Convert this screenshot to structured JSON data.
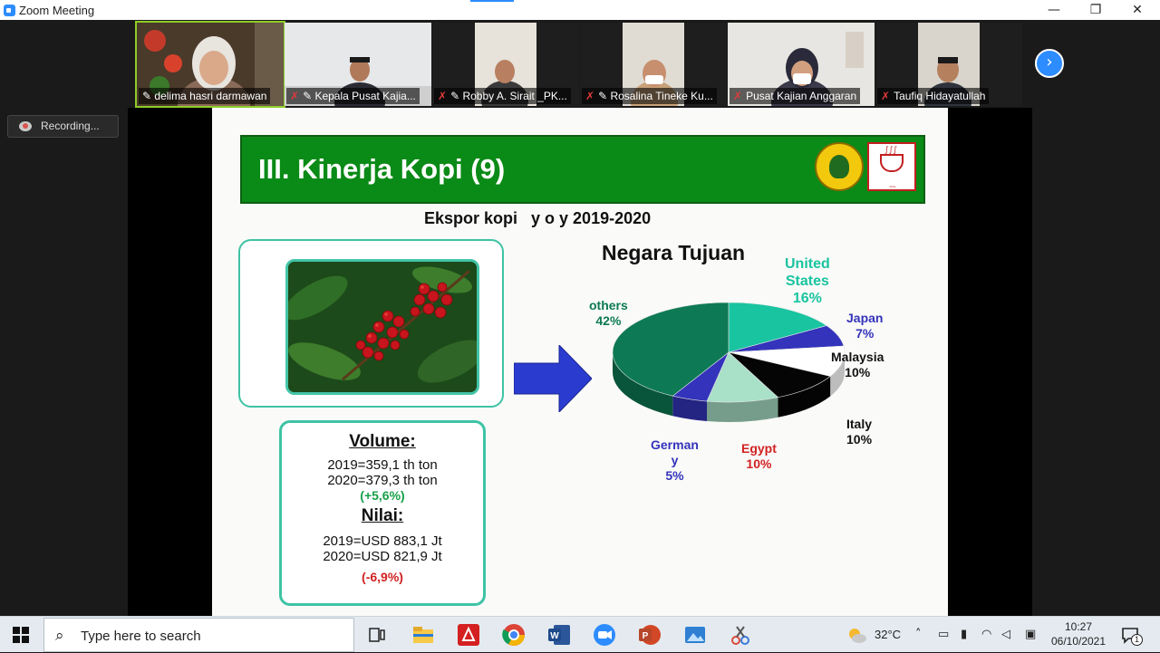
{
  "window": {
    "title": "Zoom Meeting",
    "minimize": "—",
    "maximize": "❐",
    "close": "✕"
  },
  "participants": [
    {
      "name": "delima hasri darmawan",
      "muted": false,
      "pinned": true,
      "active": true
    },
    {
      "name": "Kepala Pusat Kajia...",
      "muted": true,
      "pinned": true
    },
    {
      "name": "Robby A. Sirait _PK...",
      "muted": true,
      "pinned": true
    },
    {
      "name": "Rosalina Tineke Ku...",
      "muted": true,
      "pinned": true
    },
    {
      "name": "Pusat Kajian Anggaran",
      "muted": true,
      "pinned": false
    },
    {
      "name": "Taufiq Hidayatullah",
      "muted": true,
      "pinned": false
    }
  ],
  "next_page": "›",
  "recording": {
    "label": "Recording..."
  },
  "slide": {
    "title": "III. Kinerja Kopi  (9)",
    "subtitle": "Ekspor kopi   y o y 2019-2020",
    "chart_heading": "Negara Tujuan",
    "volume": {
      "heading": "Volume:",
      "line1": "2019=359,1 th ton",
      "line2": "2020=379,3 th ton",
      "change": "(+5,6%)"
    },
    "value": {
      "heading": "Nilai:",
      "line1": "2019=USD 883,1 Jt",
      "line2": "2020=USD 821,9 Jt",
      "change": "(-6,9%)"
    },
    "logo2_text": "Specialty Coffee Association of Indonesia"
  },
  "chart_data": {
    "type": "pie",
    "title": "Negara Tujuan",
    "slices": [
      {
        "label": "United States",
        "label_lines": [
          "United",
          "States"
        ],
        "value": 16,
        "display": "16%",
        "color": "#19c4a0",
        "label_color": "#19c4a0"
      },
      {
        "label": "Japan",
        "label_lines": [
          "Japan"
        ],
        "value": 7,
        "display": "7%",
        "color": "#3333bb",
        "label_color": "#3333bb"
      },
      {
        "label": "Malaysia",
        "label_lines": [
          "Malaysia"
        ],
        "value": 10,
        "display": "10%",
        "color": "#ffffff",
        "label_color": "#111111"
      },
      {
        "label": "Italy",
        "label_lines": [
          "Italy"
        ],
        "value": 10,
        "display": "10%",
        "color": "#050505",
        "label_color": "#111111"
      },
      {
        "label": "Egypt",
        "label_lines": [
          "Egypt"
        ],
        "value": 10,
        "display": "10%",
        "color": "#a8e0c8",
        "label_color": "#d12222"
      },
      {
        "label": "Germany",
        "label_lines": [
          "German",
          "y"
        ],
        "value": 5,
        "display": "5%",
        "color": "#3333bb",
        "label_color": "#3333bb"
      },
      {
        "label": "others",
        "label_lines": [
          "others"
        ],
        "value": 42,
        "display": "42%",
        "color": "#0d7a55",
        "label_color": "#0d7a55"
      }
    ]
  },
  "taskbar": {
    "search_placeholder": "Type here to search",
    "temperature": "32°C",
    "time": "10:27",
    "date": "06/10/2021",
    "notification_count": "1"
  }
}
